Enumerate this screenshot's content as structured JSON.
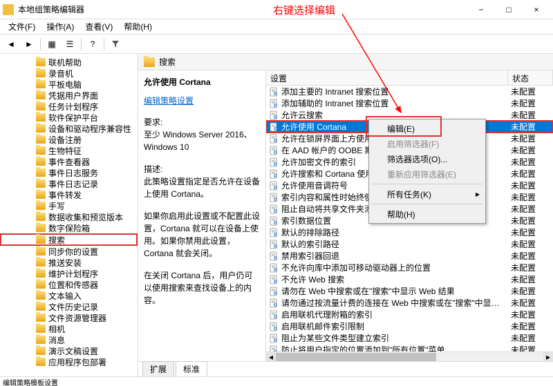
{
  "window": {
    "title": "本地组策略编辑器",
    "minimize": "−",
    "maximize": "□",
    "close": "×"
  },
  "annotation": "右键选择编辑",
  "menubar": [
    {
      "label": "文件(F)"
    },
    {
      "label": "操作(A)"
    },
    {
      "label": "查看(V)"
    },
    {
      "label": "帮助(H)"
    }
  ],
  "tree": [
    {
      "label": "联机帮助"
    },
    {
      "label": "录音机"
    },
    {
      "label": "平板电脑"
    },
    {
      "label": "凭据用户界面"
    },
    {
      "label": "任务计划程序"
    },
    {
      "label": "软件保护平台"
    },
    {
      "label": "设备和驱动程序兼容性"
    },
    {
      "label": "设备注册"
    },
    {
      "label": "生物特征"
    },
    {
      "label": "事件查看器"
    },
    {
      "label": "事件日志服务"
    },
    {
      "label": "事件日志记录"
    },
    {
      "label": "事件转发"
    },
    {
      "label": "手写"
    },
    {
      "label": "数据收集和预览版本"
    },
    {
      "label": "数字保险箱"
    },
    {
      "label": "搜索",
      "highlighted": true
    },
    {
      "label": "同步你的设置"
    },
    {
      "label": "推送安装"
    },
    {
      "label": "维护计划程序"
    },
    {
      "label": "位置和传感器"
    },
    {
      "label": "文本输入"
    },
    {
      "label": "文件历史记录"
    },
    {
      "label": "文件资源管理器"
    },
    {
      "label": "相机"
    },
    {
      "label": "消息"
    },
    {
      "label": "演示文稿设置"
    },
    {
      "label": "应用程序包部署"
    }
  ],
  "content": {
    "header": "搜索",
    "detail": {
      "title": "允许使用 Cortana",
      "edit_link": "编辑策略设置",
      "req_label": "要求:",
      "req_text": "至少 Windows Server 2016、Windows 10",
      "desc_label": "描述:",
      "desc_1": "此策略设置指定是否允许在设备上使用 Cortana。",
      "desc_2": "如果你启用此设置或不配置此设置，Cortana 就可以在设备上使用。如果你禁用此设置，Cortana 就会关闭。",
      "desc_3": "在关闭 Cortana 后，用户仍可以使用搜索来查找设备上的内容。"
    },
    "columns": {
      "setting": "设置",
      "state": "状态"
    },
    "rows": [
      {
        "label": "添加主要的 Intranet 搜索位置",
        "state": "未配置"
      },
      {
        "label": "添加辅助的 Intranet 搜索位置",
        "state": "未配置"
      },
      {
        "label": "允许云搜索",
        "state": "未配置"
      },
      {
        "label": "允许使用 Cortana",
        "state": "未配置",
        "selected": true,
        "highlighted": true
      },
      {
        "label": "允许在锁屏界面上方使用 Cortana",
        "state": "未配置"
      },
      {
        "label": "在 AAD 帐户的 OOBE 期间允许 Cortana 页面",
        "state": "未配置"
      },
      {
        "label": "允许加密文件的索引",
        "state": "未配置"
      },
      {
        "label": "允许搜索和 Cortana 使用位置",
        "state": "未配置"
      },
      {
        "label": "允许使用音调符号",
        "state": "未配置"
      },
      {
        "label": "索引内容和属性时始终使用自动语言检测",
        "state": "未配置"
      },
      {
        "label": "阻止自动将共享文件夹添加到 Windows Search 索引",
        "state": "未配置"
      },
      {
        "label": "索引数据位置",
        "state": "未配置"
      },
      {
        "label": "默认的排除路径",
        "state": "未配置"
      },
      {
        "label": "默认的索引路径",
        "state": "未配置"
      },
      {
        "label": "禁用索引器回退",
        "state": "未配置"
      },
      {
        "label": "不允许向库中添加可移动驱动器上的位置",
        "state": "未配置"
      },
      {
        "label": "不允许 Web 搜索",
        "state": "未配置"
      },
      {
        "label": "请勿在 Web 中搜索或在\"搜索\"中显示 Web 结果",
        "state": "未配置"
      },
      {
        "label": "请勿通过按流量计费的连接在 Web 中搜索或在\"搜索\"中显…",
        "state": "未配置"
      },
      {
        "label": "启用联机代理附箱的索引",
        "state": "未配置"
      },
      {
        "label": "启用联机邮件索引限制",
        "state": "未配置"
      },
      {
        "label": "阻止为某些文件类型建立索引",
        "state": "未配置"
      },
      {
        "label": "防止将用户指定的位置添加到\"所有位置\"菜单",
        "state": "未配置"
      }
    ],
    "tabs": [
      {
        "label": "扩展"
      },
      {
        "label": "标准",
        "active": true
      }
    ]
  },
  "context_menu": [
    {
      "label": "编辑(E)"
    },
    {
      "label": "启用筛选器(F)",
      "disabled": true
    },
    {
      "label": "筛选器选项(O)..."
    },
    {
      "label": "重新应用筛选器(E)",
      "disabled": true
    },
    {
      "sep": true
    },
    {
      "label": "所有任务(K)",
      "arrow": true
    },
    {
      "sep": true
    },
    {
      "label": "帮助(H)"
    }
  ],
  "statusbar": "编辑策略模板设置"
}
